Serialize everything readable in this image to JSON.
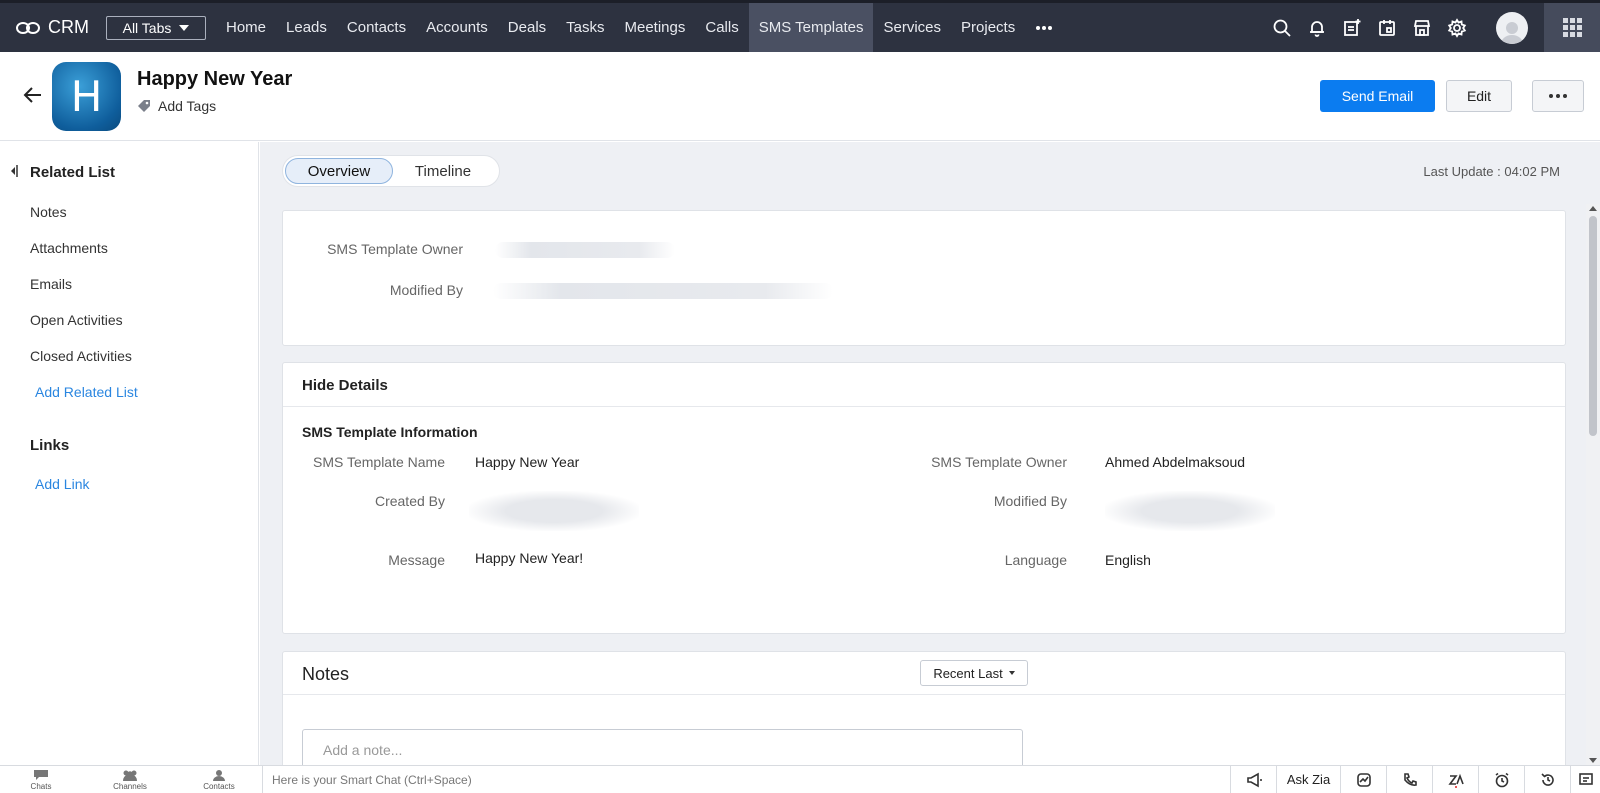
{
  "app": {
    "brand": "CRM",
    "all_tabs": "All Tabs"
  },
  "nav": {
    "tabs": [
      "Home",
      "Leads",
      "Contacts",
      "Accounts",
      "Deals",
      "Tasks",
      "Meetings",
      "Calls",
      "SMS Templates",
      "Services",
      "Projects"
    ],
    "active_tab": "SMS Templates",
    "icons": [
      "search-icon",
      "bell-icon",
      "note-add-icon",
      "calendar-icon",
      "store-icon",
      "gear-icon"
    ]
  },
  "record": {
    "avatar_letter": "H",
    "title": "Happy New Year",
    "add_tags": "Add Tags",
    "send_email": "Send Email",
    "edit": "Edit"
  },
  "sidebar": {
    "related_title": "Related List",
    "items": [
      "Notes",
      "Attachments",
      "Emails",
      "Open Activities",
      "Closed Activities"
    ],
    "add_related": "Add Related List",
    "links_title": "Links",
    "add_link": "Add Link"
  },
  "tabs": {
    "overview": "Overview",
    "timeline": "Timeline"
  },
  "last_update": "Last Update : 04:02 PM",
  "summary": {
    "owner_label": "SMS Template Owner",
    "modified_label": "Modified By"
  },
  "details": {
    "hide_details": "Hide Details",
    "section_title": "SMS Template Information",
    "name_label": "SMS Template Name",
    "name_value": "Happy New Year",
    "owner_label": "SMS Template Owner",
    "owner_value": "Ahmed Abdelmaksoud",
    "created_label": "Created By",
    "modified_label": "Modified By",
    "message_label": "Message",
    "message_value": "Happy New Year!",
    "language_label": "Language",
    "language_value": "English"
  },
  "notes": {
    "title": "Notes",
    "sort": "Recent Last",
    "placeholder": "Add a note..."
  },
  "bottombar": {
    "chats": "Chats",
    "channels": "Channels",
    "contacts": "Contacts",
    "smart_chat": "Here is your Smart Chat (Ctrl+Space)",
    "ask_zia": "Ask Zia"
  },
  "colors": {
    "nav_bg": "#2d3240",
    "primary": "#0b7cf0",
    "link": "#2a86e0",
    "main_bg": "#eef0f4"
  }
}
